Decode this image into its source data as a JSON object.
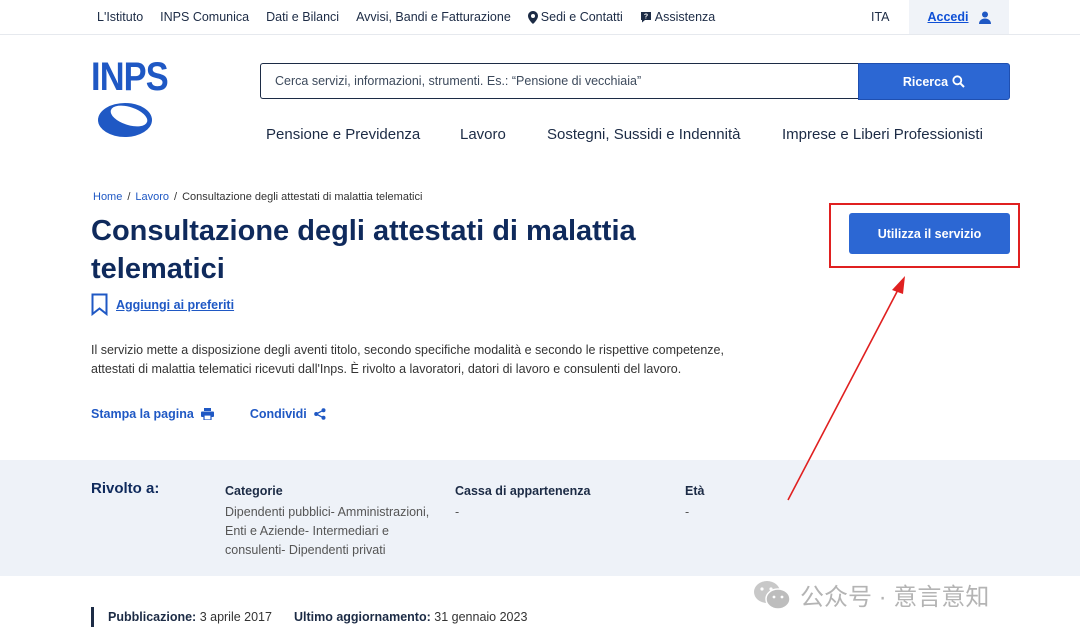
{
  "topbar": {
    "items": [
      {
        "label": "L'Istituto"
      },
      {
        "label": "INPS Comunica"
      },
      {
        "label": "Dati e Bilanci"
      },
      {
        "label": "Avvisi, Bandi e Fatturazione"
      },
      {
        "label": "Sedi e Contatti",
        "icon": "location-pin-icon"
      },
      {
        "label": "Assistenza",
        "icon": "help-chat-icon"
      }
    ],
    "lang": "ITA",
    "login_label": "Accedi"
  },
  "logo": {
    "text": "INPS"
  },
  "search": {
    "placeholder": "Cerca servizi, informazioni, strumenti. Es.: “Pensione di vecchiaia”",
    "button_label": "Ricerca"
  },
  "mainnav": [
    {
      "label": "Pensione e Previdenza"
    },
    {
      "label": "Lavoro"
    },
    {
      "label": "Sostegni, Sussidi e Indennità"
    },
    {
      "label": "Imprese e Liberi Professionisti"
    }
  ],
  "breadcrumb": {
    "items": [
      "Home",
      "Lavoro",
      "Consultazione degli attestati di malattia telematici"
    ],
    "separator": "/"
  },
  "page": {
    "title": "Consultazione degli attestati di malattia telematici",
    "favorite_label": "Aggiungi ai preferiti",
    "description": "Il servizio mette a disposizione degli aventi titolo, secondo specifiche modalità e secondo le rispettive competenze, attestati di malattia telematici ricevuti dall'Inps. È rivolto a lavoratori, datori di lavoro e consulenti del lavoro.",
    "print_label": "Stampa la pagina",
    "share_label": "Condividi",
    "cta_label": "Utilizza il servizio"
  },
  "audience": {
    "heading": "Rivolto a:",
    "columns": [
      {
        "header": "Categorie",
        "value": "Dipendenti pubblici- Amministrazioni, Enti e Aziende- Intermediari e consulenti- Dipendenti privati"
      },
      {
        "header": "Cassa di appartenenza",
        "value": "-"
      },
      {
        "header": "Età",
        "value": "-"
      }
    ]
  },
  "meta": {
    "published_label": "Pubblicazione:",
    "published_value": "3 aprile 2017",
    "updated_label": "Ultimo aggiornamento:",
    "updated_value": "31 gennaio 2023"
  },
  "watermark": {
    "text": "公众号 · 意言意知"
  },
  "colors": {
    "brand_blue": "#2c67d3",
    "title_navy": "#0f2a5c",
    "band_bg": "#eef2f8",
    "highlight_red": "#e02020"
  }
}
